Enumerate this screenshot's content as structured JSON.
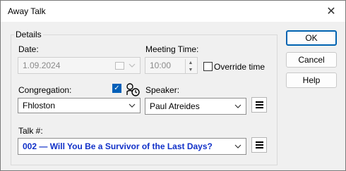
{
  "window": {
    "title": "Away Talk"
  },
  "details": {
    "legend": "Details",
    "date_label": "Date:",
    "date_value": "1.09.2024",
    "meeting_time_label": "Meeting Time:",
    "meeting_time_value": "10:00",
    "override_time_label": "Override time",
    "override_time_checked": false,
    "congregation_label": "Congregation:",
    "congregation_value": "Fhloston",
    "congregation_checkbox_checked": true,
    "speaker_label": "Speaker:",
    "speaker_value": "Paul Atreides",
    "talk_label": "Talk #:",
    "talk_value": "002 — Will You Be a Survivor of the Last Days?"
  },
  "buttons": {
    "ok": "OK",
    "cancel": "Cancel",
    "help": "Help"
  },
  "colors": {
    "accent": "#005fb8",
    "talk_text": "#1030c8",
    "default_button_border": "#0063b1"
  }
}
